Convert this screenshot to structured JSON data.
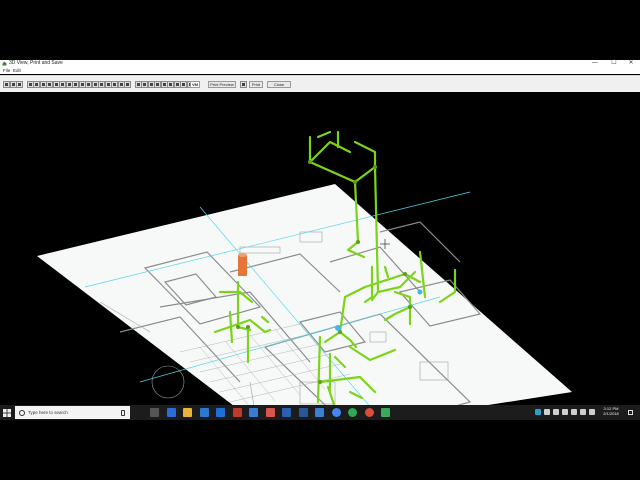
{
  "window": {
    "title": "3D View, Print and Save",
    "controls": {
      "minimize": "—",
      "maximize": "☐",
      "close": "✕"
    }
  },
  "menu": {
    "file": "File",
    "edit": "Edit"
  },
  "toolbar": {
    "tool_icon_count": 28,
    "vm_label": "VM",
    "print_preview": "Print Preview",
    "print": "Print",
    "close": "Close"
  },
  "taskbar": {
    "search_placeholder": "Type here to search",
    "pinned_icons": [
      "task-view-icon",
      "edge-icon",
      "file-explorer-icon",
      "store-icon",
      "dropbox-icon",
      "app-icon",
      "mail-icon",
      "app-red-icon",
      "photos-icon",
      "word-icon",
      "app-blue-icon",
      "chrome-icon",
      "xbox-icon",
      "chrome-alt-icon",
      "cad-app-icon"
    ],
    "time": "3:12 PM",
    "date": "2/1/2018"
  },
  "colors": {
    "pipe": "#7cd418",
    "pipe_dark": "#5aa012",
    "guide_line": "#56d6e6",
    "heater": "#e4763a",
    "plan_paper": "#f7f9f9",
    "taskbar": "#1c1c1c"
  }
}
